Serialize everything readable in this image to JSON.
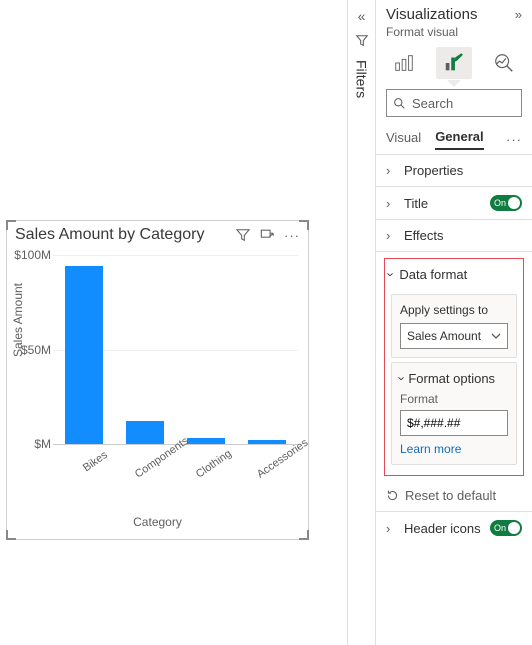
{
  "chart": {
    "title": "Sales Amount by Category",
    "ylabel": "Sales Amount",
    "xlabel": "Category",
    "yticks": [
      "$100M",
      "$50M",
      "$M"
    ]
  },
  "chart_data": {
    "type": "bar",
    "title": "Sales Amount by Category",
    "xlabel": "Category",
    "ylabel": "Sales Amount",
    "categories": [
      "Bikes",
      "Components",
      "Clothing",
      "Accessories"
    ],
    "values": [
      94000000,
      12000000,
      2000000,
      1200000
    ],
    "ylim": [
      0,
      100000000
    ],
    "y_tick_labels": [
      "$M",
      "$50M",
      "$100M"
    ],
    "bar_color": "#118DFF"
  },
  "filters": {
    "label": "Filters"
  },
  "viz": {
    "title": "Visualizations",
    "subtitle": "Format visual",
    "search_placeholder": "Search",
    "tabs": {
      "visual": "Visual",
      "general": "General"
    },
    "sections": {
      "properties": "Properties",
      "title": "Title",
      "effects": "Effects",
      "data_format": "Data format",
      "header_icons": "Header icons"
    },
    "toggle_on": "On",
    "apply_settings_label": "Apply settings to",
    "apply_settings_value": "Sales Amount",
    "format_options_label": "Format options",
    "format_field_label": "Format",
    "format_value": "$#,###.##",
    "learn_more": "Learn more",
    "reset": "Reset to default"
  }
}
